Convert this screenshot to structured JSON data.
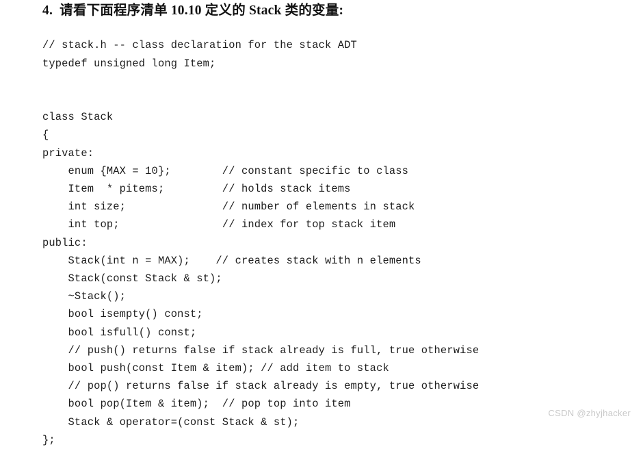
{
  "document": {
    "heading": "4.  请看下面程序清单 10.10 定义的 Stack 类的变量:",
    "code_lines": [
      "// stack.h -- class declaration for the stack ADT",
      "typedef unsigned long Item;",
      "",
      "",
      "class Stack",
      "{",
      "private:",
      "    enum {MAX = 10};        // constant specific to class",
      "    Item  * pitems;         // holds stack items",
      "    int size;               // number of elements in stack",
      "    int top;                // index for top stack item",
      "public:",
      "    Stack(int n = MAX);    // creates stack with n elements",
      "    Stack(const Stack & st);",
      "    ~Stack();",
      "    bool isempty() const;",
      "    bool isfull() const;",
      "    // push() returns false if stack already is full, true otherwise",
      "    bool push(const Item & item); // add item to stack",
      "    // pop() returns false if stack already is empty, true otherwise",
      "    bool pop(Item & item);  // pop top into item",
      "    Stack & operator=(const Stack & st);",
      "};"
    ],
    "watermark": "CSDN @zhyjhacker",
    "colors": {
      "page_background": "#ffffff",
      "text": "#1c1c1c",
      "heading": "#121212",
      "watermark": "#c9c9c9"
    }
  }
}
